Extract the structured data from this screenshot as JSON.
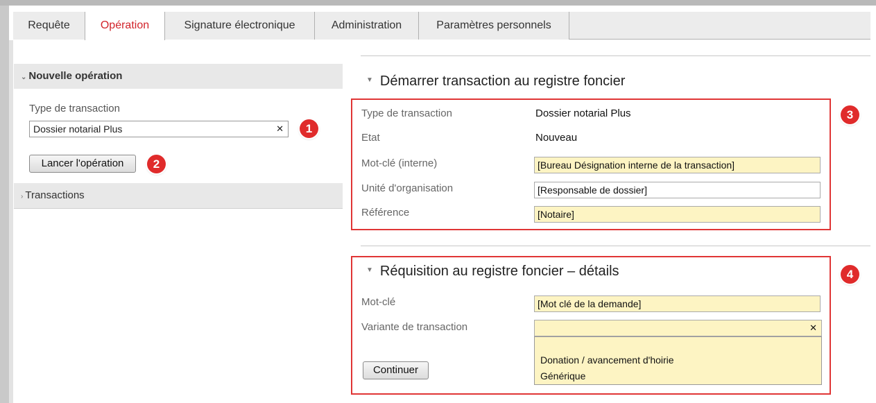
{
  "tabs": [
    {
      "label": "Requête",
      "active": false
    },
    {
      "label": "Opération",
      "active": true
    },
    {
      "label": "Signature électronique",
      "active": false
    },
    {
      "label": "Administration",
      "active": false
    },
    {
      "label": "Paramètres personnels",
      "active": false
    }
  ],
  "left_panel": {
    "new_operation_header": "Nouvelle opération",
    "transaction_type_label": "Type de transaction",
    "transaction_type_value": "Dossier notarial Plus",
    "launch_button": "Lancer l'opération",
    "transactions_header": "Transactions"
  },
  "badges": [
    "1",
    "2",
    "3",
    "4"
  ],
  "start_panel": {
    "title": "Démarrer transaction au registre foncier",
    "fields": [
      {
        "label": "Type de transaction",
        "value": "Dossier notarial Plus"
      },
      {
        "label": "Etat",
        "value": "Nouveau"
      },
      {
        "label": "Mot-clé (interne)",
        "value": "[Bureau Désignation interne de la transaction]"
      },
      {
        "label": "Unité d'organisation",
        "value": "[Responsable de dossier]"
      },
      {
        "label": "Référence",
        "value": "[Notaire]"
      }
    ]
  },
  "details_panel": {
    "title": "Réquisition au registre foncier – détails",
    "keyword_label": "Mot-clé",
    "keyword_value": "[Mot clé de la demande]",
    "variant_label": "Variante de transaction",
    "variant_value": "",
    "variant_options": [
      "Donation / avancement d'hoirie",
      "Générique"
    ],
    "continue_button": "Continuer"
  },
  "colors": {
    "accent_red": "#d2232a",
    "highlight_box": "#e03535",
    "input_yellow": "#fdf4c3"
  }
}
